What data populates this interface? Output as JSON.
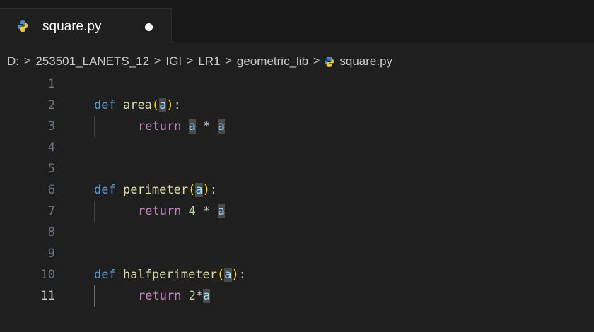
{
  "tab": {
    "title": "square.py",
    "icon": "python-file-icon",
    "dirty": true
  },
  "breadcrumb": {
    "items": [
      "D:",
      "253501_LANETS_12",
      "IGI",
      "LR1",
      "geometric_lib",
      "square.py"
    ],
    "separator": ">"
  },
  "editor": {
    "active_line": 11,
    "lines": [
      {
        "num": "1"
      },
      {
        "num": "2",
        "t": [
          "def",
          "area",
          "(",
          "a",
          "):"
        ]
      },
      {
        "num": "3",
        "t": [
          "return",
          "a",
          "*",
          "a"
        ]
      },
      {
        "num": "4"
      },
      {
        "num": "5"
      },
      {
        "num": "6",
        "t": [
          "def",
          "perimeter",
          "(",
          "a",
          "):"
        ]
      },
      {
        "num": "7",
        "t": [
          "return",
          "4",
          "*",
          "a"
        ]
      },
      {
        "num": "8"
      },
      {
        "num": "9"
      },
      {
        "num": "10",
        "t": [
          "def",
          "halfperimeter",
          "(",
          "a",
          "):"
        ]
      },
      {
        "num": "11",
        "t": [
          "return",
          "2",
          "*",
          "a"
        ]
      }
    ]
  },
  "colors": {
    "background": "#1f1f1f",
    "keyword": "#569cd6",
    "function": "#dcdcaa",
    "return": "#c586c0",
    "number": "#b5cea8",
    "bracket": "#ffd700",
    "highlight": "#4a4a4a"
  }
}
